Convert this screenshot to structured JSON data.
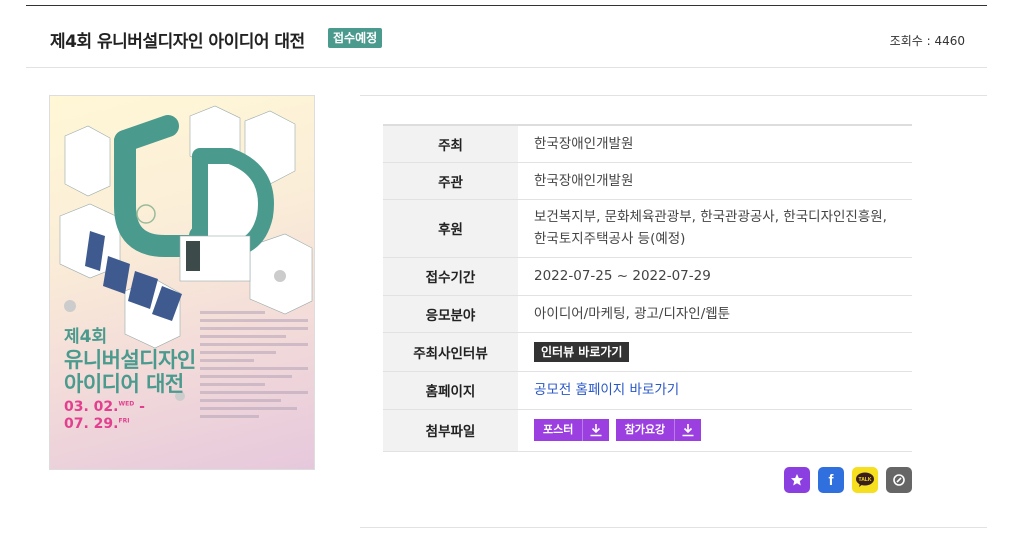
{
  "header": {
    "title": "제4회 유니버설디자인 아이디어 대전",
    "status_badge": "접수예정",
    "views": "조회수 : 4460"
  },
  "poster": {
    "title_line1": "제4회",
    "title_line2": "유니버설디자인",
    "title_line3": "아이디어 대전",
    "date_start": "03. 02.",
    "date_start_day": "WED",
    "date_sep": "-",
    "date_end": "07. 29.",
    "date_end_day": "FRI",
    "colors": {
      "accent": "#4a9a8e",
      "date": "#e2408e"
    }
  },
  "info": {
    "rows": [
      {
        "label": "주최",
        "value": "한국장애인개발원"
      },
      {
        "label": "주관",
        "value": "한국장애인개발원"
      },
      {
        "label": "후원",
        "value_line1": "보건복지부, 문화체육관광부, 한국관광공사, 한국디자인진흥원,",
        "value_line2": "한국토지주택공사 등(예정)"
      },
      {
        "label": "접수기간",
        "value": "2022-07-25 ~ 2022-07-29"
      },
      {
        "label": "응모분야",
        "value": "아이디어/마케팅, 광고/디자인/웹툰"
      },
      {
        "label": "주최사인터뷰",
        "button": "인터뷰 바로가기"
      },
      {
        "label": "홈페이지",
        "link": "공모전 홈페이지 바로가기"
      },
      {
        "label": "첨부파일",
        "files": [
          "포스터",
          "참가요강"
        ]
      }
    ]
  },
  "share": {
    "icons": [
      "star-icon",
      "facebook-icon",
      "kakaotalk-icon",
      "link-icon"
    ],
    "kakao_label": "TALK",
    "facebook_glyph": "f"
  }
}
